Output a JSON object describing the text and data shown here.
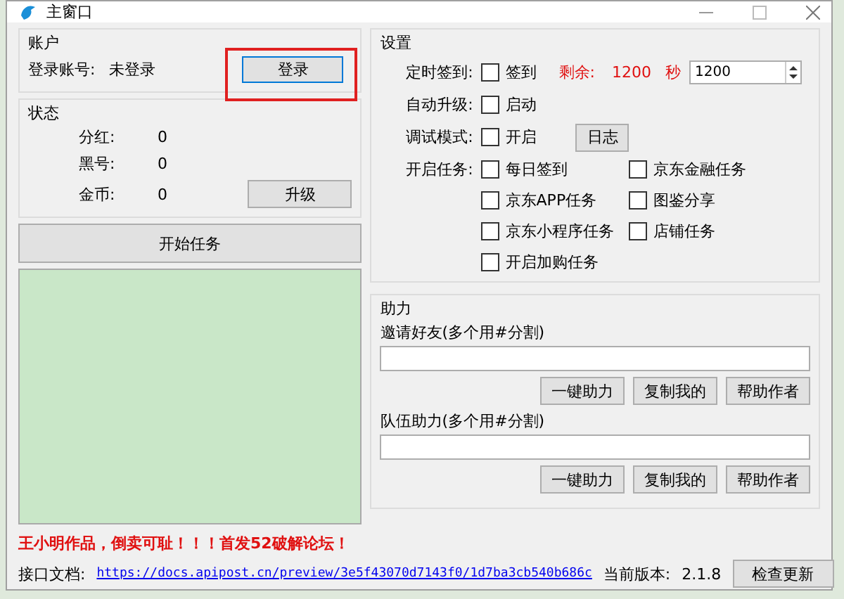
{
  "window": {
    "title": "主窗口"
  },
  "account": {
    "title": "账户",
    "login_label": "登录账号:",
    "login_value": "未登录",
    "login_button": "登录",
    "login_highlighted": true
  },
  "status": {
    "title": "状态",
    "items": [
      {
        "label": "分红:",
        "value": "0"
      },
      {
        "label": "黑号:",
        "value": "0"
      },
      {
        "label": "金币:",
        "value": "0"
      }
    ],
    "upgrade_button": "升级"
  },
  "start_button": "开始任务",
  "settings": {
    "title": "设置",
    "timed_sign": {
      "label": "定时签到:",
      "checkbox": {
        "label": "签到",
        "checked": false
      },
      "remaining_label": "剩余:",
      "remaining_value": "1200",
      "unit": "秒",
      "spin_value": "1200"
    },
    "auto_upgrade": {
      "label": "自动升级:",
      "checkbox": {
        "label": "启动",
        "checked": false
      }
    },
    "debug": {
      "label": "调试模式:",
      "checkbox": {
        "label": "开启",
        "checked": false
      },
      "log_button": "日志"
    },
    "tasks": {
      "label": "开启任务:",
      "items": [
        {
          "label": "每日签到",
          "checked": false
        },
        {
          "label": "京东金融任务",
          "checked": false
        },
        {
          "label": "京东APP任务",
          "checked": false
        },
        {
          "label": "图鉴分享",
          "checked": false
        },
        {
          "label": "京东小程序任务",
          "checked": false
        },
        {
          "label": "店铺任务",
          "checked": false
        },
        {
          "label": "开启加购任务",
          "checked": false
        }
      ]
    }
  },
  "assist": {
    "title": "助力",
    "groups": [
      {
        "label": "邀请好友(多个用#分割)",
        "buttons": [
          "一键助力",
          "复制我的",
          "帮助作者"
        ]
      },
      {
        "label": "队伍助力(多个用#分割)",
        "buttons": [
          "一键助力",
          "复制我的",
          "帮助作者"
        ]
      }
    ]
  },
  "footer": {
    "notice": "王小明作品，倒卖可耻！！！首发52破解论坛！",
    "doc_label": "接口文档:",
    "doc_link": "https://docs.apipost.cn/preview/3e5f43070d7143f0/1d7ba3cb540b686c",
    "version_label": "当前版本:",
    "version_value": "2.1.8",
    "update_button": "检查更新"
  }
}
